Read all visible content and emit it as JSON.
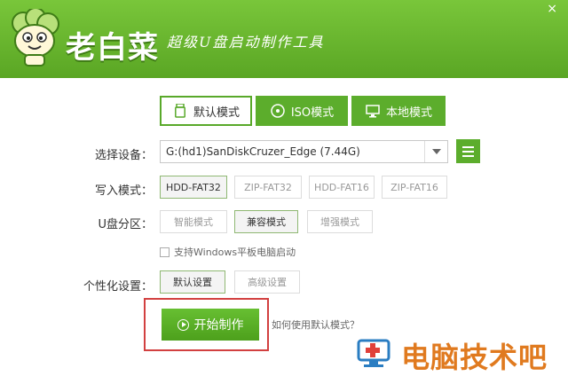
{
  "header": {
    "app_title": "老白菜",
    "slogan": "超级U盘启动制作工具",
    "close_glyph": "×"
  },
  "tabs": [
    {
      "label": "默认模式",
      "icon": "usb-drive-icon",
      "active": true
    },
    {
      "label": "ISO模式",
      "icon": "disc-icon",
      "active": false
    },
    {
      "label": "本地模式",
      "icon": "monitor-icon",
      "active": false
    }
  ],
  "device": {
    "label": "选择设备：",
    "value": "G:(hd1)SanDiskCruzer_Edge (7.44G)"
  },
  "write_mode": {
    "label": "写入模式：",
    "options": [
      "HDD-FAT32",
      "ZIP-FAT32",
      "HDD-FAT16",
      "ZIP-FAT16"
    ],
    "selected": "HDD-FAT32"
  },
  "partition": {
    "label": "U盘分区：",
    "options": [
      "智能模式",
      "兼容模式",
      "增强模式"
    ],
    "selected": "兼容模式"
  },
  "tablet_support": {
    "label": "支持Windows平板电脑启动",
    "checked": false
  },
  "personalize": {
    "label": "个性化设置：",
    "options": [
      "默认设置",
      "高级设置"
    ],
    "selected": "默认设置"
  },
  "start_button": {
    "label": "开始制作",
    "icon": "play-icon"
  },
  "help_link": "如何使用默认模式？",
  "watermark": {
    "text": "电脑技术吧",
    "icon": "computer-plus-icon"
  },
  "colors": {
    "accent": "#5cad2c",
    "highlight_border": "#d24040",
    "watermark": "#e07a1f"
  }
}
